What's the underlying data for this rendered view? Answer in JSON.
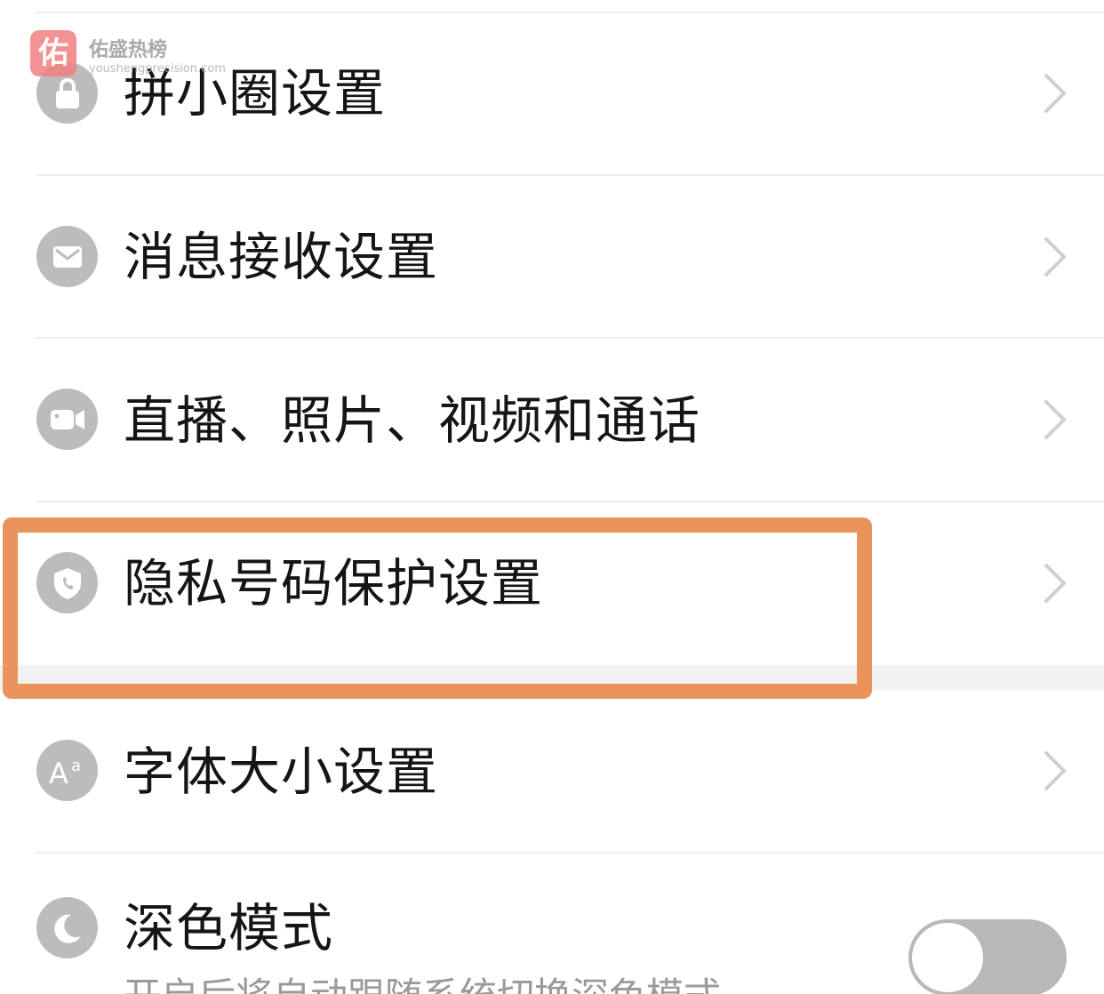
{
  "watermark": {
    "logo_char": "佑",
    "title": "佑盛热榜",
    "url": "youshengprecision.com"
  },
  "settings": [
    {
      "label": "拼小圈设置",
      "icon": "lock-icon"
    },
    {
      "label": "消息接收设置",
      "icon": "envelope-icon"
    },
    {
      "label": "直播、照片、视频和通话",
      "icon": "video-camera-icon"
    },
    {
      "label": "隐私号码保护设置",
      "icon": "shield-phone-icon"
    },
    {
      "label": "字体大小设置",
      "icon": "font-size-icon"
    }
  ],
  "dark_mode": {
    "label": "深色模式",
    "icon": "moon-icon",
    "description": "开启后将自动跟随系统切换深色模式",
    "enabled": false
  },
  "colors": {
    "highlight": "#e8945a",
    "icon_bg": "#bcbcbc"
  }
}
